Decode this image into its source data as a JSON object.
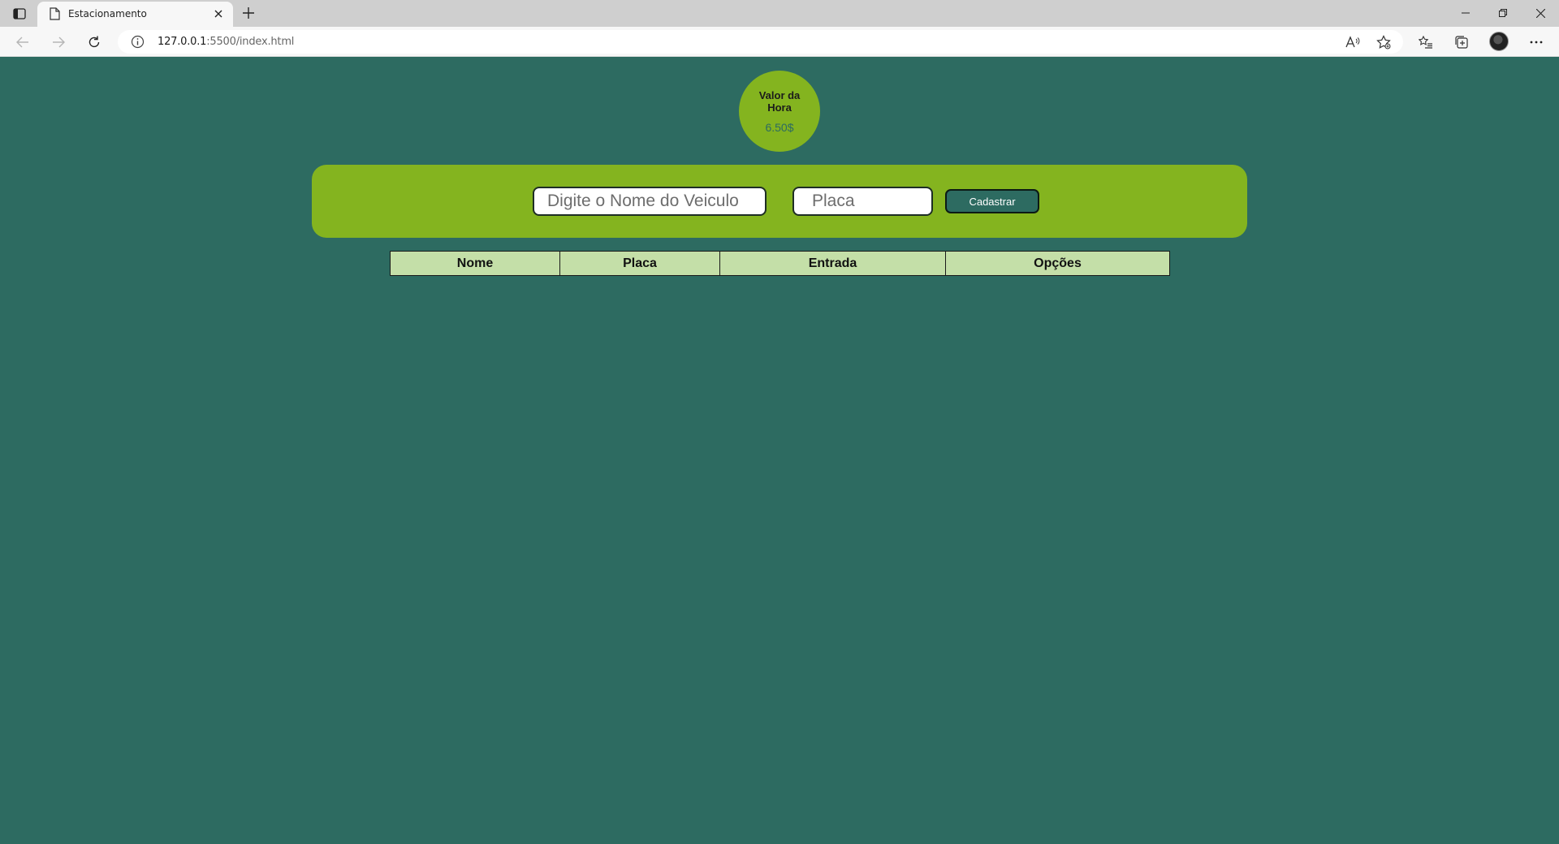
{
  "browser": {
    "tab_title": "Estacionamento",
    "url_host": "127.0.0.1",
    "url_rest": ":5500/index.html",
    "icons": [
      "sidebar-toggle-icon",
      "page-icon",
      "close-icon",
      "plus-icon",
      "minimize-icon",
      "restore-icon",
      "window-close-icon",
      "back-arrow-icon",
      "forward-arrow-icon",
      "reload-icon",
      "info-icon",
      "read-aloud-icon",
      "favorite-star-icon",
      "favorites-list-icon",
      "collections-icon",
      "more-icon"
    ]
  },
  "rate": {
    "title": "Valor da Hora",
    "value": "6.50$"
  },
  "form": {
    "name_placeholder": "Digite o Nome do Veiculo",
    "plate_placeholder": "Placa",
    "submit_label": "Cadastrar"
  },
  "table": {
    "headers": [
      "Nome",
      "Placa",
      "Entrada",
      "Opções"
    ]
  },
  "colors": {
    "background": "#2d6b61",
    "panel": "#84b41f",
    "table_header": "#c4dfa8"
  }
}
